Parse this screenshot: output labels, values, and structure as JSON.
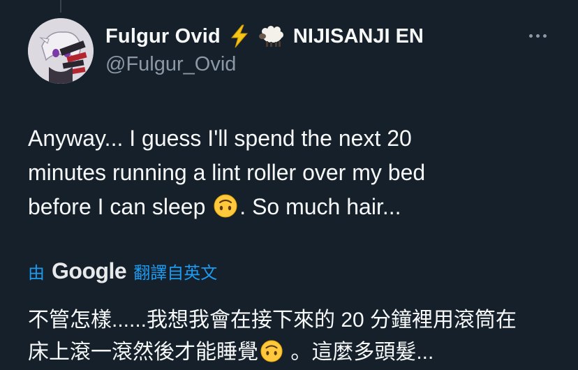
{
  "tweet": {
    "author": {
      "display_name": "Fulgur Ovid",
      "affiliation": "NIJISANJI EN",
      "handle": "@Fulgur_Ovid",
      "badges": [
        "lightning-icon",
        "sheep-icon"
      ]
    },
    "text_lines": [
      "Anyway... I guess I'll spend the next 20",
      "minutes running a lint roller over my bed",
      "before I can sleep",
      ". So much hair..."
    ],
    "text_emoji": "upside-down-face-icon"
  },
  "translation": {
    "by_label": "由",
    "provider": "Google",
    "from_label": "翻譯自英文",
    "text_lines": [
      "不管怎樣......我想我會在接下來的 20 分鐘裡用滾筒在",
      "床上滾一滾然後才能睡覺",
      "。這麼多頭髮..."
    ]
  },
  "colors": {
    "background": "#15202b",
    "text_primary": "#f7f9f9",
    "text_secondary": "#8b98a5",
    "link_accent": "#1d9bf0"
  }
}
